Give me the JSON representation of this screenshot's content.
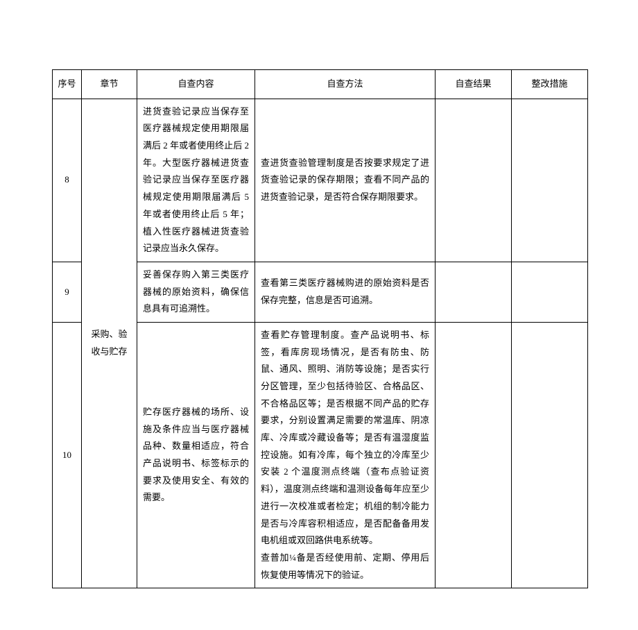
{
  "header": {
    "col1": "序号",
    "col2": "章节",
    "col3": "自查内容",
    "col4": "自查方法",
    "col5": "自查结果",
    "col6": "整改措施"
  },
  "chapter": "采购、验收与贮存",
  "rows": [
    {
      "num": "8",
      "content": "进货查验记录应当保存至医疗器械规定使用期限届满后 2 年或者使用终止后 2 年。大型医疗器械进货查验记录应当保存至医疗器械规定使用期限届满后 5 年或者使用终止后 5 年；植入性医疗器械进货查验记录应当永久保存。",
      "method": "查进货查验管理制度是否按要求规定了进货查验记录的保存期限；查看不同产品的进货查验记录，是否符合保存期限要求。",
      "result": "",
      "fix": ""
    },
    {
      "num": "9",
      "content": "妥善保存购入第三类医疗器械的原始资料，确保信息具有可追溯性。",
      "method": "查看第三类医疗器械购进的原始资料是否保存完整，信息是否可追溯。",
      "result": "",
      "fix": ""
    },
    {
      "num": "10",
      "content": "贮存医疗器械的场所、设施及条件应当与医疗器械品种、数量相适应，符合产品说明书、标签标示的要求及使用安全、有效的需要。",
      "method": "查看贮存管理制度。查产品说明书、标签，看库房现场情况，是否有防虫、防鼠、通风、照明、消防等设施；是否实行分区管理，至少包括待验区、合格品区、不合格品区等；是否根据不同产品的贮存要求，分别设置满足需要的常温库、阴凉库、冷库或冷藏设备等；是否有温湿度监控设施。如有冷库，每个独立的冷库至少安装 2 个温度测点终端（查布点验证资料），温度测点终端和温测设备每年应至少进行一次校准或者检定；机组的制冷能力是否与冷库容积相适应，是否配备备用发电机组或双回路供电系统等。\n查普加¼备是否经使用前、定期、停用后恢复使用等情况下的验证。",
      "result": "",
      "fix": ""
    }
  ]
}
